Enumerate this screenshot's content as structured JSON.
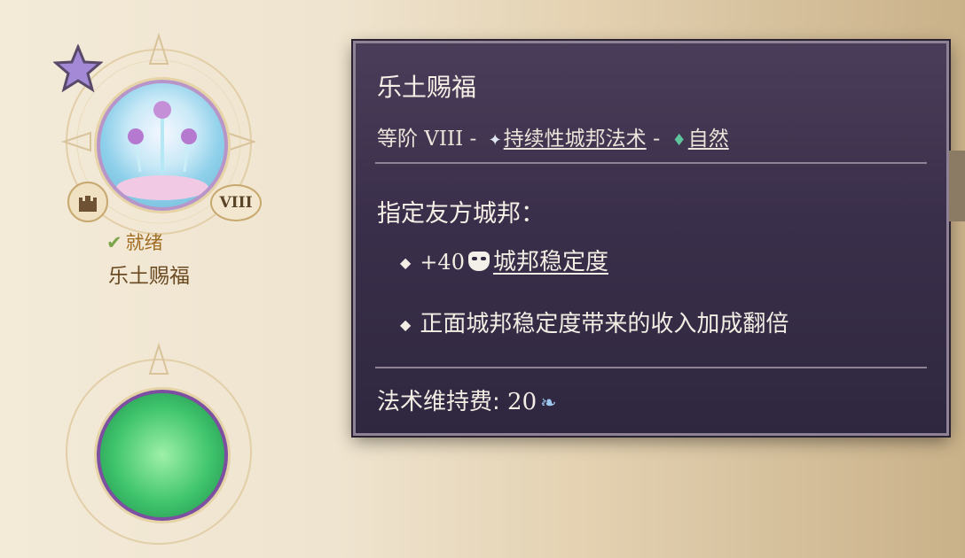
{
  "spell_card": {
    "tier_badge": "VIII",
    "status": "就绪",
    "name": "乐土赐福"
  },
  "tooltip": {
    "title": "乐土赐福",
    "tier_label": "等阶 VIII - ",
    "category": "持续性城邦法术",
    "separator": " - ",
    "element": "自然",
    "target": "指定友方城邦：",
    "effects": [
      {
        "value": "+40",
        "link": "城邦稳定度"
      },
      {
        "text": "正面城邦稳定度带来的收入加成翻倍"
      }
    ],
    "upkeep_label": "法术维持费: ",
    "upkeep_value": "20"
  },
  "icons": {
    "star": "star-icon",
    "castle": "castle-icon",
    "check": "check-icon",
    "gem": "gem-icon",
    "leaf": "leaf-icon",
    "mask": "stability-mask-icon",
    "mana": "mana-icon"
  },
  "colors": {
    "tooltip_bg": "#3a2f4a",
    "tooltip_border": "#8f8296",
    "status_text": "#a16e24",
    "nature_green": "#5fc49c"
  }
}
